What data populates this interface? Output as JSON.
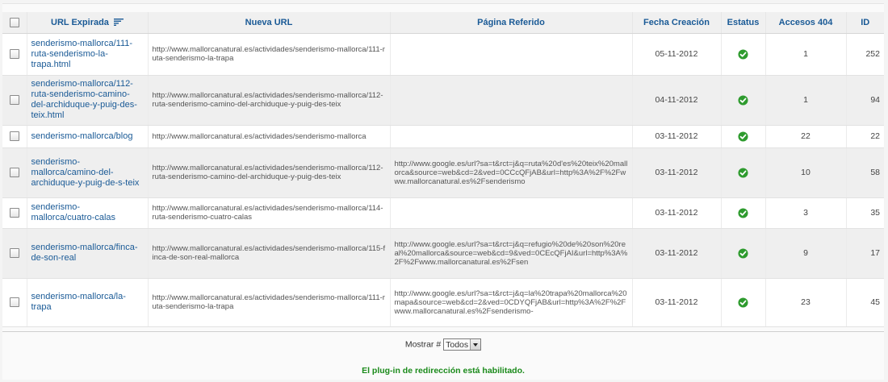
{
  "columns": {
    "url": "URL Expirada",
    "new_url": "Nueva URL",
    "referrer": "Página Referido",
    "date": "Fecha Creación",
    "status": "Estatus",
    "hits": "Accesos 404",
    "id": "ID"
  },
  "rows": [
    {
      "url": "senderismo-mallorca/111-ruta-senderismo-la-trapa.html",
      "new_url": "http://www.mallorcanatural.es/actividades/senderismo-mallorca/111-ruta-senderismo-la-trapa",
      "referrer": "",
      "date": "05-11-2012",
      "hits": "1",
      "id": "252"
    },
    {
      "url": "senderismo-mallorca/112-ruta-senderismo-camino-del-archiduque-y-puig-des-teix.html",
      "new_url": "http://www.mallorcanatural.es/actividades/senderismo-mallorca/112-ruta-senderismo-camino-del-archiduque-y-puig-des-teix",
      "referrer": "",
      "date": "04-11-2012",
      "hits": "1",
      "id": "94"
    },
    {
      "url": "senderismo-mallorca/blog",
      "new_url": "http://www.mallorcanatural.es/actividades/senderismo-mallorca",
      "referrer": "",
      "date": "03-11-2012",
      "hits": "22",
      "id": "22"
    },
    {
      "url": "senderismo-mallorca/camino-del-archiduque-y-puig-de-s-teix",
      "new_url": "http://www.mallorcanatural.es/actividades/senderismo-mallorca/112-ruta-senderismo-camino-del-archiduque-y-puig-des-teix",
      "referrer": "http://www.google.es/url?sa=t&rct=j&q=ruta%20d'es%20teix%20mallorca&source=web&cd=2&ved=0CCcQFjAB&url=http%3A%2F%2Fwww.mallorcanatural.es%2Fsenderismo",
      "date": "03-11-2012",
      "hits": "10",
      "id": "58"
    },
    {
      "url": "senderismo-mallorca/cuatro-calas",
      "new_url": "http://www.mallorcanatural.es/actividades/senderismo-mallorca/114-ruta-senderismo-cuatro-calas",
      "referrer": "",
      "date": "03-11-2012",
      "hits": "3",
      "id": "35"
    },
    {
      "url": "senderismo-mallorca/finca-de-son-real",
      "new_url": "http://www.mallorcanatural.es/actividades/senderismo-mallorca/115-finca-de-son-real-mallorca",
      "referrer": "http://www.google.es/url?sa=t&rct=j&q=refugio%20de%20son%20real%20mallorca&source=web&cd=9&ved=0CEcQFjAI&url=http%3A%2F%2Fwww.mallorcanatural.es%2Fsen",
      "date": "03-11-2012",
      "hits": "9",
      "id": "17"
    },
    {
      "url": "senderismo-mallorca/la-trapa",
      "new_url": "http://www.mallorcanatural.es/actividades/senderismo-mallorca/111-ruta-senderismo-la-trapa",
      "referrer": "http://www.google.es/url?sa=t&rct=j&q=la%20trapa%20mallorca%20mapa&source=web&cd=2&ved=0CDYQFjAB&url=http%3A%2F%2Fwww.mallorcanatural.es%2Fsenderismo-",
      "date": "03-11-2012",
      "hits": "23",
      "id": "45"
    }
  ],
  "footer": {
    "show_label": "Mostrar #",
    "show_value": "Todos",
    "status_message": "El plug-in de redirección está habilitado."
  },
  "colors": {
    "header_text": "#1a5a96",
    "link": "#1a5a96",
    "status_ok": "#2e9b2e",
    "message": "#1a8a1a"
  },
  "icons": {
    "sort": "sort-descending-icon",
    "status": "check-circle-icon"
  }
}
